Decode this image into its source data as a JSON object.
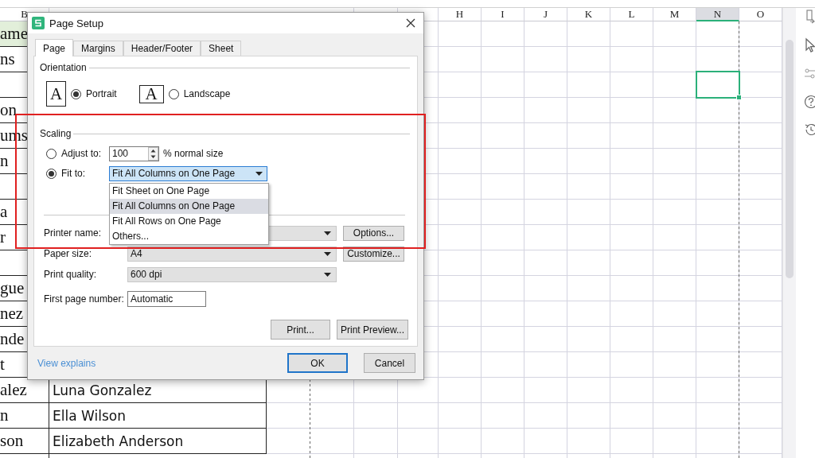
{
  "sheet": {
    "column_headers": [
      {
        "label": "B",
        "selected": false
      },
      {
        "label": "H",
        "selected": false
      },
      {
        "label": "I",
        "selected": false
      },
      {
        "label": "J",
        "selected": false
      },
      {
        "label": "K",
        "selected": false
      },
      {
        "label": "L",
        "selected": false
      },
      {
        "label": "M",
        "selected": false
      },
      {
        "label": "N",
        "selected": true
      },
      {
        "label": "O",
        "selected": false
      }
    ],
    "rows": [
      {
        "kind": "header",
        "column_b": "ame",
        "selected": false
      },
      {
        "kind": "data",
        "column_b": "ns",
        "selected": false
      },
      {
        "kind": "data",
        "selected": true
      },
      {
        "kind": "data",
        "column_b": "on",
        "selected": false
      },
      {
        "kind": "data",
        "column_b": "ums",
        "selected": false
      },
      {
        "kind": "data",
        "column_b": "n",
        "selected": false
      },
      {
        "kind": "data",
        "selected": false
      },
      {
        "kind": "data",
        "column_b": "a",
        "selected": false
      },
      {
        "kind": "data",
        "column_b": "r",
        "selected": false
      },
      {
        "kind": "data",
        "selected": false
      },
      {
        "kind": "data",
        "column_b": "gue",
        "selected": false
      },
      {
        "kind": "data",
        "column_b": "nez",
        "selected": false
      },
      {
        "kind": "data",
        "column_b": "nde",
        "selected": false
      },
      {
        "kind": "data",
        "column_b": "t",
        "selected": false
      },
      {
        "kind": "data",
        "column_b": "alez",
        "column_c": "Luna Gonzalez",
        "selected": false
      },
      {
        "kind": "data",
        "column_b": "n",
        "column_c": "Ella Wilson",
        "selected": false
      },
      {
        "kind": "data",
        "column_b": "son",
        "column_c": "Elizabeth Anderson",
        "selected": false
      },
      {
        "kind": "data",
        "selected": false
      }
    ]
  },
  "dialog": {
    "title": "Page Setup",
    "tabs": [
      {
        "label": "Page",
        "selected": true
      },
      {
        "label": "Margins",
        "selected": false
      },
      {
        "label": "Header/Footer",
        "selected": false
      },
      {
        "label": "Sheet",
        "selected": false
      }
    ],
    "orientation": {
      "legend": "Orientation",
      "options": [
        {
          "label": "Portrait",
          "glyph": "A",
          "kind": "portrait",
          "selected": true
        },
        {
          "label": "Landscape",
          "glyph": "A",
          "kind": "landscape",
          "selected": false
        }
      ]
    },
    "scaling": {
      "legend": "Scaling",
      "adjust_to": {
        "label": "Adjust to:",
        "selected": false,
        "value": "100",
        "suffix": "% normal size"
      },
      "fit_to": {
        "label": "Fit to:",
        "selected": true,
        "value": "Fit All Columns on One Page"
      },
      "dropdown_options": [
        {
          "label": "Fit Sheet on One Page",
          "selected": false
        },
        {
          "label": "Fit All Columns on One Page",
          "selected": true
        },
        {
          "label": "Fit All Rows on One Page",
          "selected": false
        },
        {
          "label": "Others...",
          "selected": false
        }
      ]
    },
    "fields": [
      {
        "label": "Printer name:",
        "kind": "select",
        "button": "Options..."
      },
      {
        "label": "Paper size:",
        "kind": "select",
        "value": "A4",
        "button": "Customize..."
      },
      {
        "label": "Print quality:",
        "kind": "select",
        "value": "600 dpi"
      },
      {
        "label": "First page number:",
        "kind": "text",
        "value": "Automatic"
      }
    ],
    "panel_buttons": [
      "Print...",
      "Print Preview..."
    ],
    "link": "View explains",
    "buttons": [
      {
        "label": "OK",
        "kind": "default"
      },
      {
        "label": "Cancel",
        "kind": "normal"
      }
    ]
  }
}
